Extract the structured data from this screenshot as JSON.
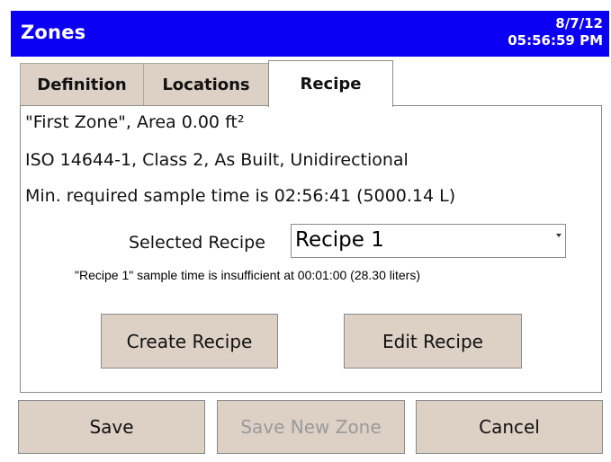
{
  "window": {
    "title": "Zones",
    "date": "8/7/12",
    "time": "05:56:59 PM"
  },
  "tabs": [
    {
      "label": "Definition",
      "active": false
    },
    {
      "label": "Locations",
      "active": false
    },
    {
      "label": "Recipe",
      "active": true
    }
  ],
  "recipe": {
    "zone_line": "\"First Zone\", Area 0.00 ft²",
    "standard_line": "ISO 14644-1, Class 2, As Built, Unidirectional",
    "min_time_line": "Min. required sample time is 02:56:41 (5000.14 L)",
    "selected_label": "Selected Recipe",
    "selected_value": "Recipe 1",
    "warning": "\"Recipe 1\" sample time is insufficient at 00:01:00 (28.30 liters)",
    "create_label": "Create Recipe",
    "edit_label": "Edit Recipe"
  },
  "footer": {
    "save_label": "Save",
    "save_new_label": "Save New Zone",
    "cancel_label": "Cancel"
  },
  "colors": {
    "titlebar": "#0b00f4",
    "button_face": "#ddd0c5",
    "disabled_text": "#9a9a9a"
  }
}
